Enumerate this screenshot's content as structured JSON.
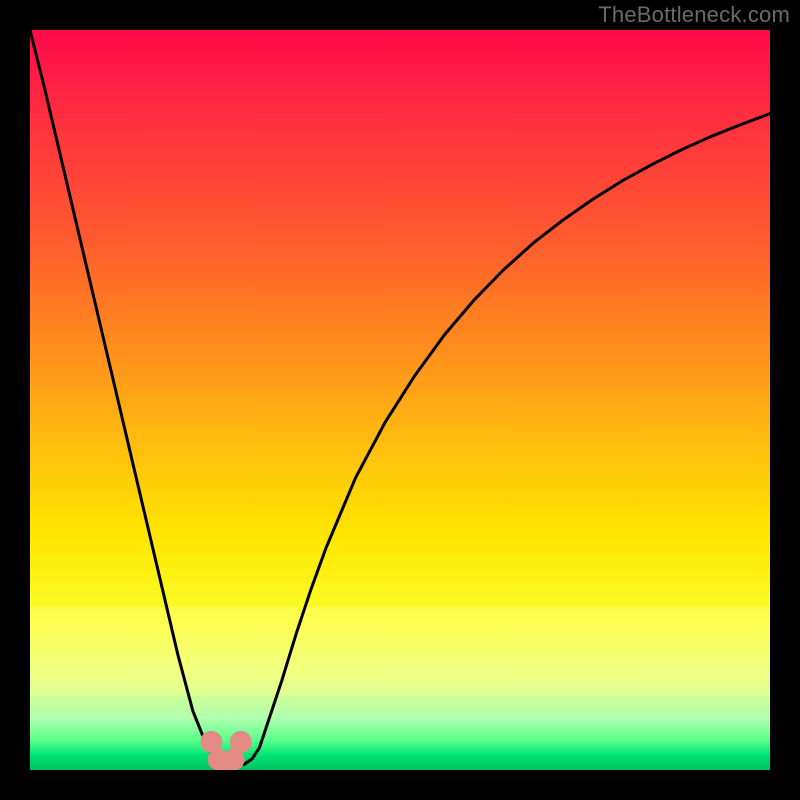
{
  "watermark": {
    "text": "TheBottleneck.com"
  },
  "colors": {
    "curve_stroke": "#000000",
    "marker_fill": "#e38a82",
    "background_black": "#000000"
  },
  "chart_data": {
    "type": "line",
    "title": "",
    "xlabel": "",
    "ylabel": "",
    "xlim": [
      0,
      100
    ],
    "ylim": [
      0,
      100
    ],
    "grid": false,
    "legend": false,
    "x": [
      0,
      2,
      4,
      6,
      8,
      10,
      12,
      14,
      16,
      18,
      20,
      22,
      24,
      25,
      26,
      27,
      28,
      29,
      30,
      31,
      32,
      34,
      36,
      38,
      40,
      44,
      48,
      52,
      56,
      60,
      64,
      68,
      72,
      76,
      80,
      84,
      88,
      92,
      96,
      100
    ],
    "y": [
      100,
      92,
      83.5,
      75,
      66.5,
      58,
      49.5,
      41,
      32.5,
      24,
      15.5,
      8,
      3,
      1.5,
      0.8,
      0.6,
      0.6,
      0.8,
      1.5,
      3,
      6,
      12,
      18.5,
      24.5,
      30,
      39.5,
      47,
      53.3,
      58.8,
      63.5,
      67.6,
      71.2,
      74.3,
      77.1,
      79.6,
      81.8,
      83.8,
      85.6,
      87.2,
      88.7
    ],
    "markers": {
      "x": [
        24.5,
        28.5,
        25.5,
        27.5,
        26.5
      ],
      "y": [
        3.8,
        3.8,
        1.4,
        1.4,
        1.0
      ]
    },
    "notes": "y=0 is the bottom (green) edge; y=100 is the top (red) edge. Values are approximate, read visually from the curve relative to the gradient."
  }
}
